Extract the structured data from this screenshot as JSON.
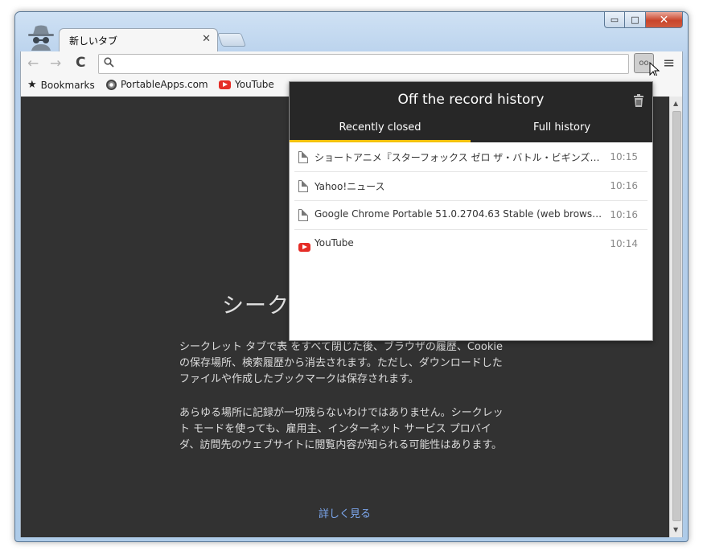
{
  "tab": {
    "title": "新しいタブ",
    "close_glyph": "✕"
  },
  "window_controls": {
    "minimize": "▭",
    "maximize": "□",
    "close": "✕"
  },
  "toolbar": {
    "back_glyph": "←",
    "forward_glyph": "→",
    "reload_glyph": "C",
    "omnibox_value": "",
    "menu_glyph": "≡",
    "extension_glyph": "oo"
  },
  "bookmarks": [
    {
      "label": "Bookmarks",
      "icon": "star-icon"
    },
    {
      "label": "PortableApps.com",
      "icon": "portableapps-icon"
    },
    {
      "label": "YouTube",
      "icon": "youtube-icon"
    }
  ],
  "incognito_page": {
    "heading": "シーク",
    "paragraph1": "シークレット タブで表\nをすべて閉じた後、ブラウザの履歴、Cookie の保存場所、検索履歴から消去されます。ただし、ダウンロードしたファイルや作成したブックマークは保存されます。",
    "paragraph2": "あらゆる場所に記録が一切残らないわけではありません。シークレット モードを使っても、雇用主、インターネット サービス プロバイダ、訪問先のウェブサイトに閲覧内容が知られる可能性はあります。",
    "learn_more": "詳しく見る"
  },
  "popup": {
    "title": "Off the record history",
    "tabs": [
      "Recently closed",
      "Full history"
    ],
    "active_tab": 0,
    "items": [
      {
        "title": "ショートアニメ『スターフォックス ゼロ ザ・バトル・ビギンズ』- You...",
        "time": "10:15",
        "icon": "document-icon"
      },
      {
        "title": "Yahoo!ニュース",
        "time": "10:16",
        "icon": "document-icon"
      },
      {
        "title": "Google Chrome Portable 51.0.2704.63 Stable (web browser...",
        "time": "10:16",
        "icon": "document-icon"
      },
      {
        "title": "YouTube",
        "time": "10:14",
        "icon": "youtube-icon"
      }
    ]
  },
  "colors": {
    "popup_header": "#272727",
    "active_tab_underline": "#f4c20d",
    "incognito_bg": "#323232",
    "link": "#7ca7ee",
    "youtube_red": "#e52d27"
  }
}
